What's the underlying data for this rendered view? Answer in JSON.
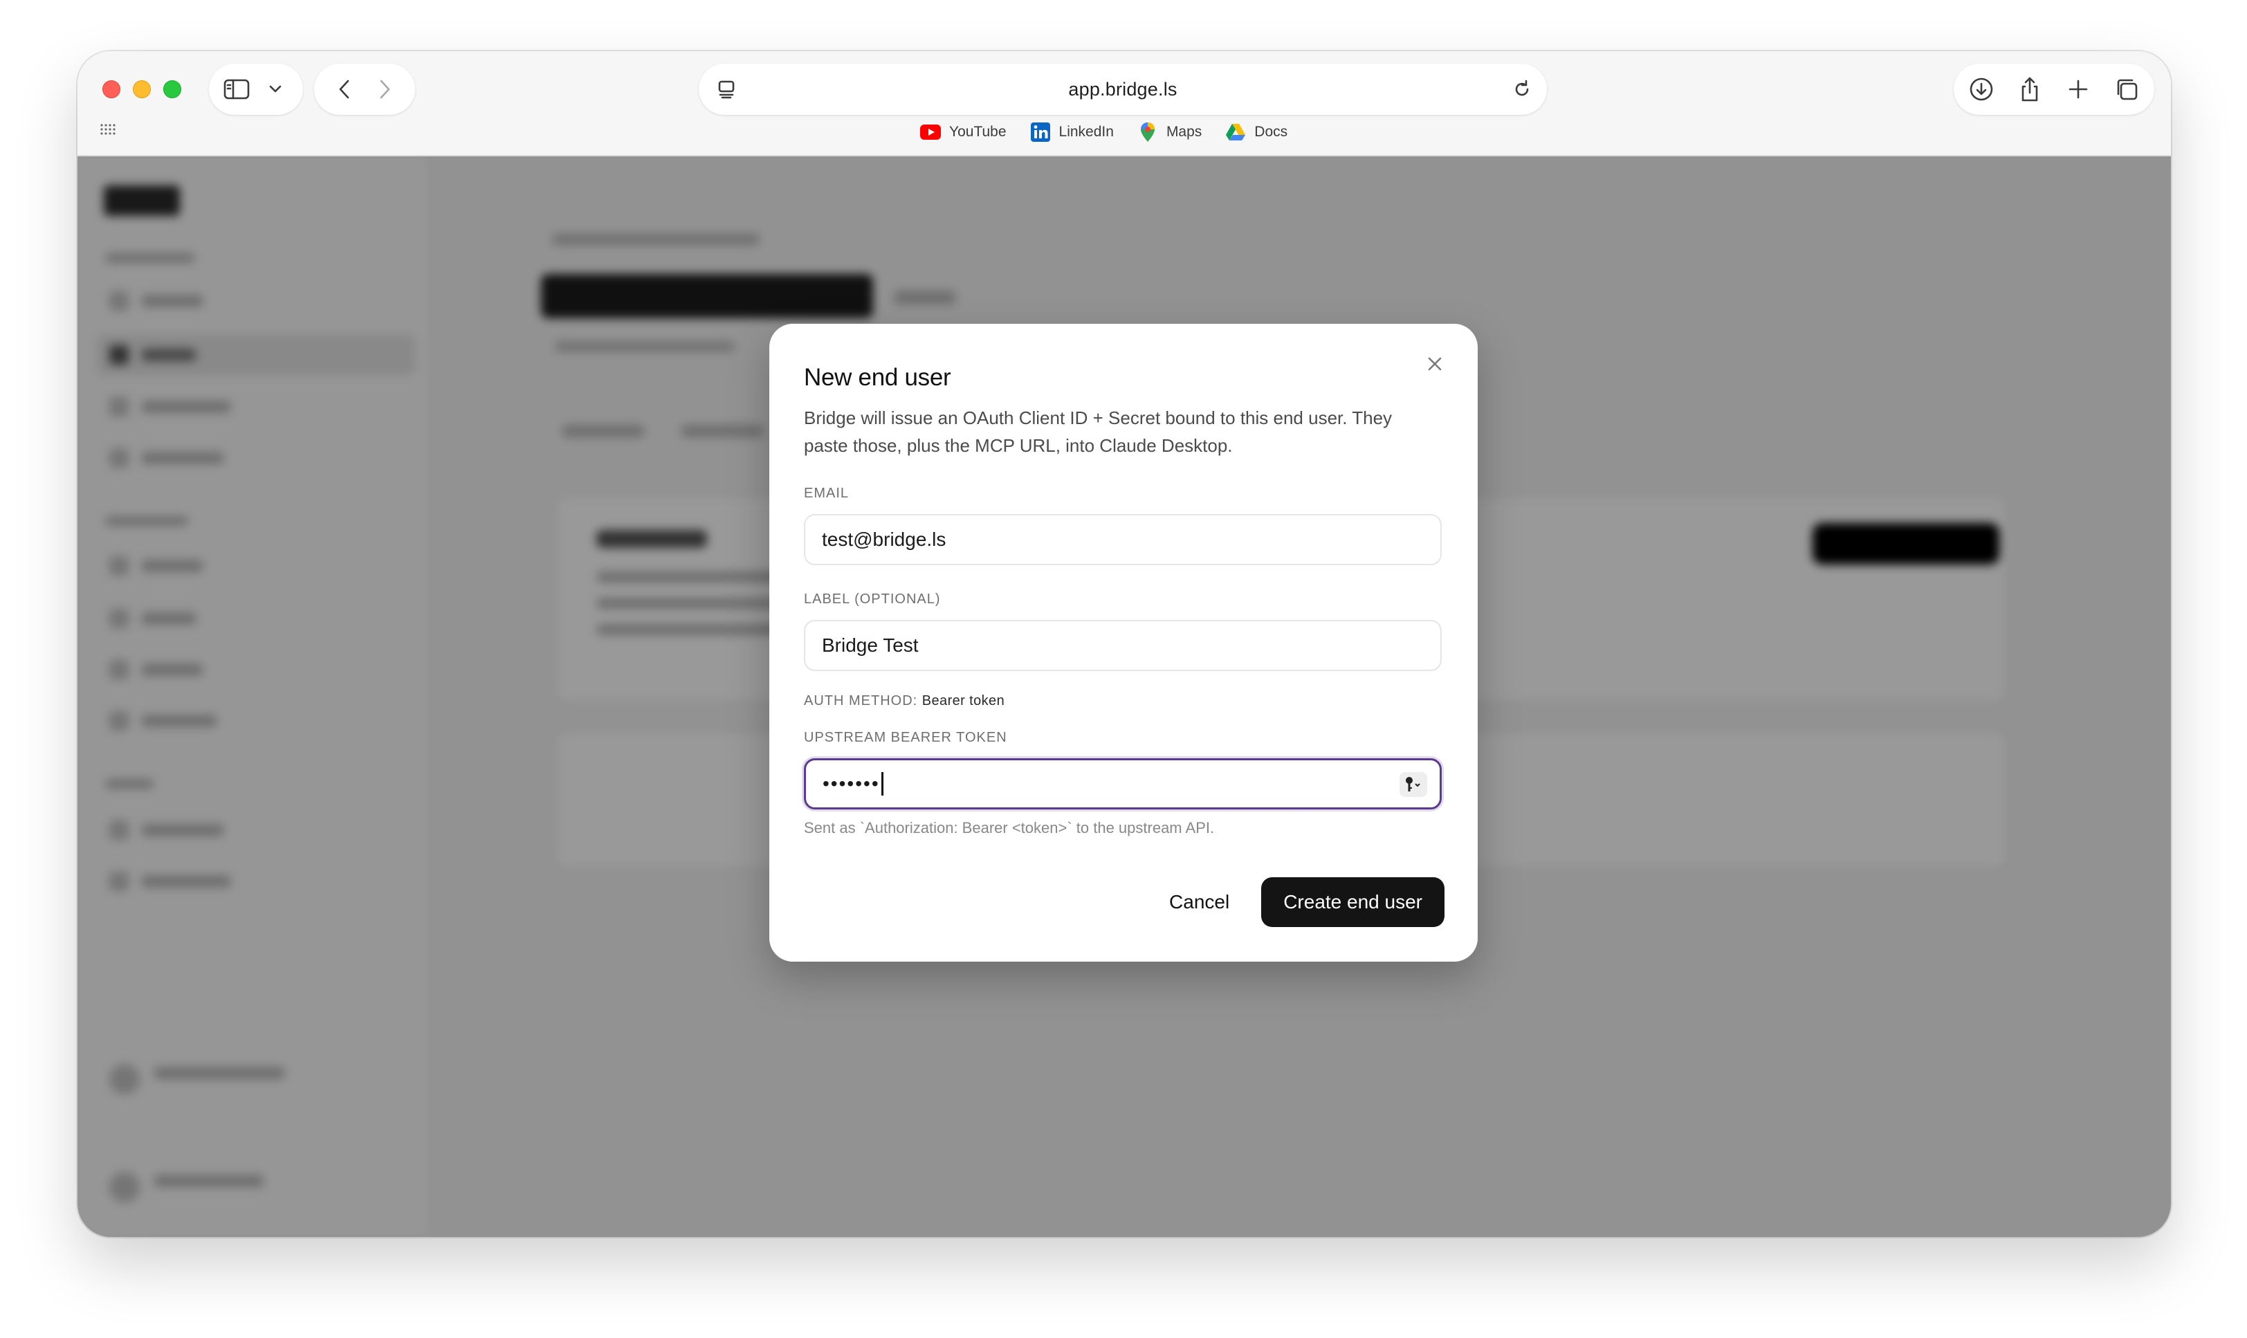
{
  "browser": {
    "url": "app.bridge.ls",
    "bookmarks": [
      {
        "label": "YouTube",
        "icon": "youtube-icon"
      },
      {
        "label": "LinkedIn",
        "icon": "linkedin-icon"
      },
      {
        "label": "Maps",
        "icon": "maps-icon"
      },
      {
        "label": "Docs",
        "icon": "drive-icon"
      }
    ]
  },
  "modal": {
    "title": "New end user",
    "description": "Bridge will issue an OAuth Client ID + Secret bound to this end user. They paste those, plus the MCP URL, into Claude Desktop.",
    "email_label": "EMAIL",
    "email_value": "test@bridge.ls",
    "label_label": "LABEL (OPTIONAL)",
    "label_value": "Bridge Test",
    "auth_method_label": "AUTH METHOD:",
    "auth_method_value": "Bearer token",
    "token_label": "UPSTREAM BEARER TOKEN",
    "token_masked": "•••••••",
    "token_help": "Sent as `Authorization: Bearer <token>` to the upstream API.",
    "cancel_label": "Cancel",
    "submit_label": "Create end user"
  },
  "colors": {
    "focus_ring": "#5b3a8f",
    "primary_button": "#141414"
  }
}
